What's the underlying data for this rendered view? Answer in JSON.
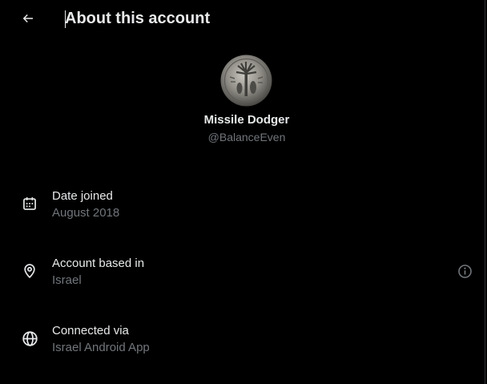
{
  "header": {
    "title": "About this account",
    "back_icon": "arrow-left-icon"
  },
  "profile": {
    "name": "Missile Dodger",
    "handle": "@BalanceEven",
    "avatar": "coin-avatar"
  },
  "details": [
    {
      "icon": "calendar-icon",
      "label": "Date joined",
      "value": "August 2018"
    },
    {
      "icon": "location-pin-icon",
      "label": "Account based in",
      "value": "Israel",
      "action_icon": "info-icon"
    },
    {
      "icon": "globe-icon",
      "label": "Connected via",
      "value": "Israel Android App"
    }
  ],
  "colors": {
    "background": "#000000",
    "primary_text": "#e7e9ea",
    "secondary_text": "#71767b",
    "border": "#2f3336"
  }
}
